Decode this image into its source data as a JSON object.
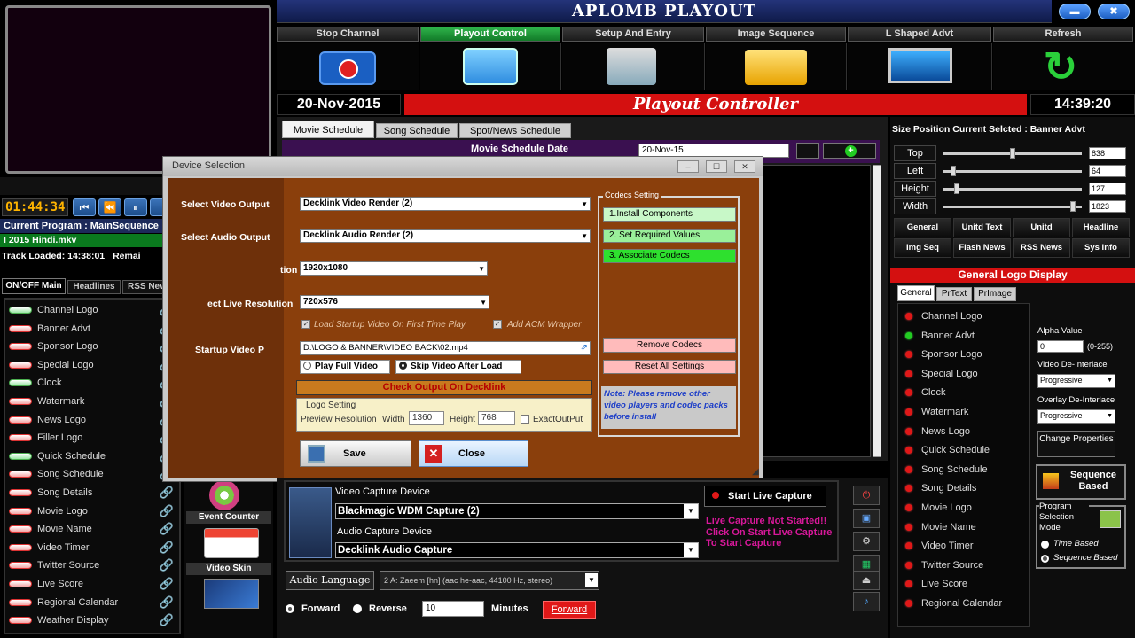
{
  "app": {
    "title": "APLOMB PLAYOUT",
    "date": "20-Nov-2015",
    "time": "14:39:20",
    "controller_title": "Playout Controller"
  },
  "top_tabs": [
    {
      "label": "Stop Channel",
      "icon": "tv-power-icon"
    },
    {
      "label": "Playout Control",
      "icon": "monitor-sun-icon"
    },
    {
      "label": "Setup And Entry",
      "icon": "computer-disk-icon"
    },
    {
      "label": "Image Sequence",
      "icon": "folder-icon"
    },
    {
      "label": "L Shaped Advt",
      "icon": "screen-icon"
    },
    {
      "label": "Refresh",
      "icon": "refresh-icon"
    }
  ],
  "left_panel": {
    "timer": "01:44:34",
    "current_program": "Current Program : MainSequence",
    "file_line": "I  2015 Hindi.mkv",
    "track_loaded": "Track Loaded:  14:38:01",
    "remain_label": "Remai",
    "tabs": [
      "ON/OFF Main",
      "Headlines",
      "RSS Nev"
    ],
    "items": [
      {
        "label": "Channel Logo",
        "on": true
      },
      {
        "label": "Banner Advt",
        "on": false
      },
      {
        "label": "Sponsor Logo",
        "on": false
      },
      {
        "label": "Special Logo",
        "on": false
      },
      {
        "label": "Clock",
        "on": true
      },
      {
        "label": "Watermark",
        "on": false
      },
      {
        "label": "News Logo",
        "on": false
      },
      {
        "label": "Filler Logo",
        "on": false
      },
      {
        "label": "Quick Schedule",
        "on": true
      },
      {
        "label": "Song Schedule",
        "on": false
      },
      {
        "label": "Song Details",
        "on": false
      },
      {
        "label": "Movie Logo",
        "on": false
      },
      {
        "label": "Movie Name",
        "on": false
      },
      {
        "label": "Video Timer",
        "on": false
      },
      {
        "label": "Twitter Source",
        "on": false
      },
      {
        "label": "Live Score",
        "on": false
      },
      {
        "label": "Regional Calendar",
        "on": false
      },
      {
        "label": "Weather Display",
        "on": false
      }
    ],
    "event_counter": "Event Counter",
    "video_skin": "Video Skin"
  },
  "schedule_tabs": [
    "Movie Schedule",
    "Song Schedule",
    "Spot/News Schedule"
  ],
  "schedule_date_label": "Movie Schedule Date",
  "schedule_date_value": "20-Nov-15",
  "dialog": {
    "title": "Device Selection",
    "labels": {
      "video_output": "Select Video Output",
      "audio_output": "Select Audio Output",
      "resolution": "tion",
      "live_resolution": "ect Live Resolution",
      "startup_video": "Startup Video P"
    },
    "video_output_value": "Decklink Video Render (2)",
    "audio_output_value": "Decklink Audio Render (2)",
    "resolution_value": "1920x1080",
    "live_resolution_value": "720x576",
    "load_startup_label": "Load Startup Video On First Time Play",
    "add_acm_label": "Add ACM Wrapper",
    "video_path": "D:\\LOGO & BANNER\\VIDEO BACK\\02.mp4",
    "play_full": "Play Full Video",
    "skip_video": "Skip Video After Load",
    "check_output": "Check Output On Decklink",
    "logo_setting": "Logo Setting",
    "preview_res_label": "Preview Resolution",
    "width_label": "Width",
    "width_value": "1360",
    "height_label": "Height",
    "height_value": "768",
    "exact_output": "ExactOutPut",
    "save": "Save",
    "close": "Close",
    "codecs": {
      "title": "Codecs Setting",
      "install": "1.Install Components",
      "set_values": "2. Set Required Values",
      "associate": "3. Associate Codecs",
      "remove": "Remove Codecs",
      "reset": "Reset All Settings",
      "note": "Note: Please remove other video players and codec packs before install"
    }
  },
  "capture": {
    "video_device_label": "Video Capture Device",
    "video_device_value": "Blackmagic WDM Capture (2)",
    "audio_device_label": "Audio Capture Device",
    "audio_device_value": "Decklink Audio Capture",
    "start_live": "Start Live Capture",
    "warning": "Live Capture Not Started!! Click On Start Live Capture To Start Capture",
    "audio_language_label": "Audio Language",
    "audio_language_value": "2 A: Zaeem [hn] (aac he-aac, 44100 Hz, stereo)",
    "forward": "Forward",
    "reverse": "Reverse",
    "minutes_value": "10",
    "minutes_label": "Minutes",
    "forward_btn": "Forward"
  },
  "right_panel": {
    "size_position_title": "Size Position Current Selcted  : Banner Advt",
    "sliders": [
      {
        "label": "Top",
        "value": "838",
        "fraction": 0.5
      },
      {
        "label": "Left",
        "value": "64",
        "fraction": 0.05
      },
      {
        "label": "Height",
        "value": "127",
        "fraction": 0.08
      },
      {
        "label": "Width",
        "value": "1823",
        "fraction": 0.95
      }
    ],
    "buttons_row1": [
      "General",
      "Unitd Text",
      "Unitd",
      "Headline"
    ],
    "buttons_row2": [
      "Img Seq",
      "Flash News",
      "RSS News",
      "Sys Info"
    ],
    "logo_display_title": "General Logo Display",
    "sub_tabs": [
      "General",
      "PrText",
      "PrImage"
    ],
    "logo_items": [
      {
        "label": "Channel Logo",
        "status": "red"
      },
      {
        "label": "Banner Advt",
        "status": "green"
      },
      {
        "label": "Sponsor Logo",
        "status": "red"
      },
      {
        "label": "Special Logo",
        "status": "red"
      },
      {
        "label": "Clock",
        "status": "red"
      },
      {
        "label": "Watermark",
        "status": "red"
      },
      {
        "label": "News Logo",
        "status": "red"
      },
      {
        "label": "Quick Schedule",
        "status": "red"
      },
      {
        "label": "Song Schedule",
        "status": "red"
      },
      {
        "label": "Song Details",
        "status": "red"
      },
      {
        "label": "Movie Logo",
        "status": "red"
      },
      {
        "label": "Movie Name",
        "status": "red"
      },
      {
        "label": "Video Timer",
        "status": "red"
      },
      {
        "label": "Twitter Source",
        "status": "red"
      },
      {
        "label": "Live Score",
        "status": "red"
      },
      {
        "label": "Regional Calendar",
        "status": "red"
      }
    ],
    "alpha_label": "Alpha Value",
    "alpha_value": "0",
    "alpha_range": "(0-255)",
    "video_deinterlace_label": "Video De-Interlace",
    "video_deinterlace_value": "Progressive",
    "overlay_deinterlace_label": "Overlay De-Interlace",
    "overlay_deinterlace_value": "Progressive",
    "change_properties": "Change Properties",
    "sequence_based": "Sequence Based",
    "program_selection": "Program Selection Mode",
    "time_based": "Time Based",
    "sequence_based_radio": "Sequence Based"
  },
  "colors": {
    "accent_blue": "#1a3a8a",
    "red_bar": "#d41010",
    "dialog_brown": "#8a3f0c",
    "green_active": "#1f9e3a"
  }
}
